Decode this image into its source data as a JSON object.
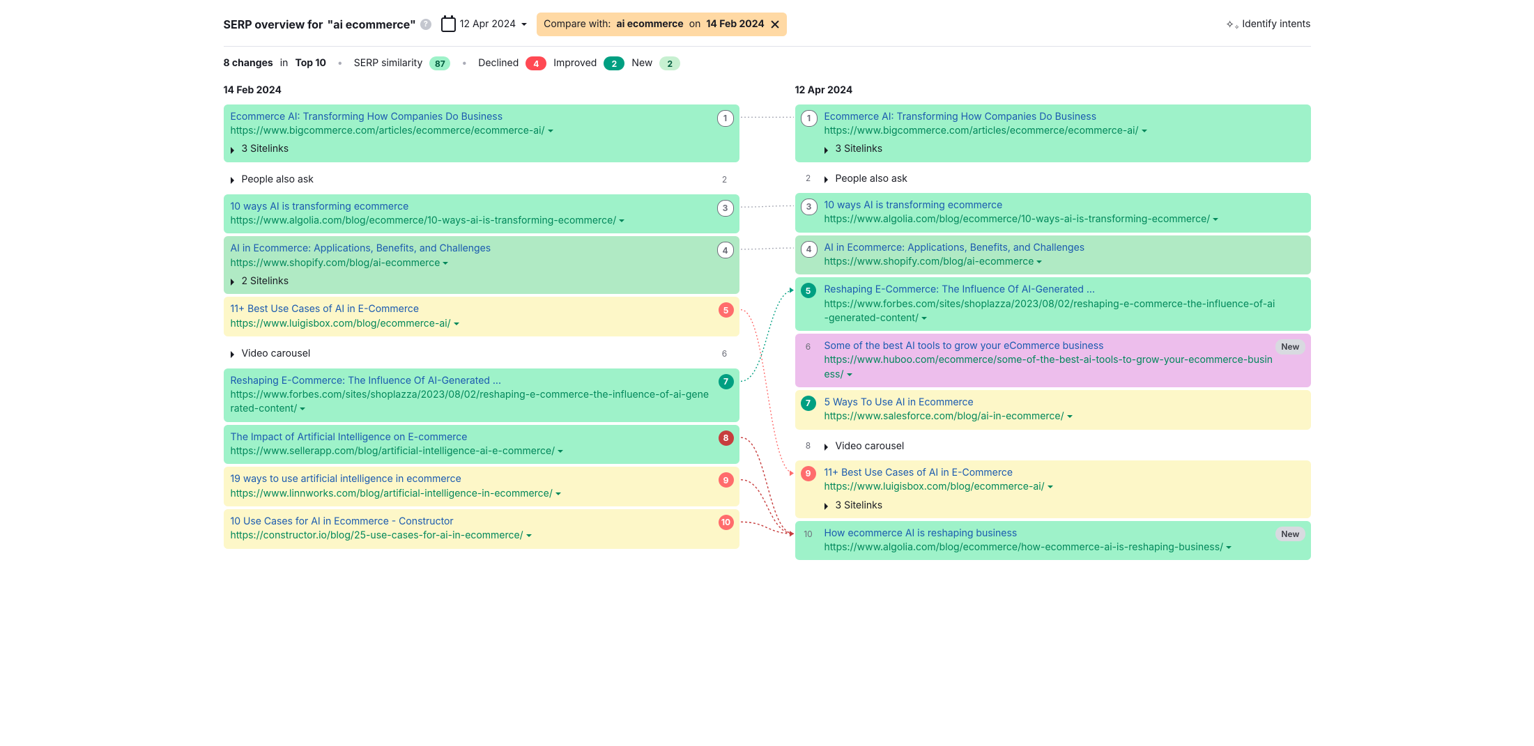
{
  "header": {
    "title_prefix": "SERP overview for",
    "query": "\"ai ecommerce\"",
    "date": "12 Apr 2024",
    "compare_prefix": "Compare with:",
    "compare_term": "ai ecommerce",
    "compare_on": "on",
    "compare_date": "14 Feb 2024",
    "identify": "Identify intents"
  },
  "stats": {
    "changes_count": "8 changes",
    "changes_suffix": " in ",
    "changes_scope": "Top 10",
    "similarity_label": "SERP similarity",
    "similarity_value": "87",
    "declined_label": "Declined",
    "declined_value": "4",
    "improved_label": "Improved",
    "improved_value": "2",
    "new_label": "New",
    "new_value": "2"
  },
  "left": {
    "date": "14 Feb 2024",
    "rows": [
      {
        "id": "l1",
        "rank": "1",
        "rank_style": "grey",
        "cls": "stable",
        "title": "Ecommerce AI: Transforming How Companies Do Business",
        "url": "https://www.bigcommerce.com/articles/ecommerce/ecommerce-ai/",
        "expander": "3 Sitelinks"
      },
      {
        "id": "l2",
        "rank": "2",
        "rank_style": "plain",
        "cls": "plain",
        "feature": "People also ask"
      },
      {
        "id": "l3",
        "rank": "3",
        "rank_style": "grey",
        "cls": "stable",
        "title": "10 ways AI is transforming ecommerce",
        "url": "https://www.algolia.com/blog/ecommerce/10-ways-ai-is-transforming-ecommerce/"
      },
      {
        "id": "l4",
        "rank": "4",
        "rank_style": "grey",
        "cls": "improved",
        "title": "AI in Ecommerce: Applications, Benefits, and Challenges",
        "url": "https://www.shopify.com/blog/ai-ecommerce",
        "expander": "2 Sitelinks"
      },
      {
        "id": "l5",
        "rank": "5",
        "rank_style": "red",
        "cls": "declined",
        "title": "11+ Best Use Cases of AI in E-Commerce",
        "url": "https://www.luigisbox.com/blog/ecommerce-ai/"
      },
      {
        "id": "l6",
        "rank": "6",
        "rank_style": "plain",
        "cls": "plain",
        "feature": "Video carousel"
      },
      {
        "id": "l7",
        "rank": "7",
        "rank_style": "green",
        "cls": "stable",
        "title": "Reshaping E-Commerce: The Influence Of AI-Generated ...",
        "url": "https://www.forbes.com/sites/shoplazza/2023/08/02/reshaping-e-commerce-the-influence-of-ai-generated-content/"
      },
      {
        "id": "l8",
        "rank": "8",
        "rank_style": "dred",
        "cls": "stable",
        "title": "The Impact of Artificial Intelligence on E-commerce",
        "url": "https://www.sellerapp.com/blog/artificial-intelligence-ai-e-commerce/"
      },
      {
        "id": "l9",
        "rank": "9",
        "rank_style": "red",
        "cls": "declined",
        "title": "19 ways to use artificial intelligence in ecommerce",
        "url": "https://www.linnworks.com/blog/artificial-intelligence-in-ecommerce/"
      },
      {
        "id": "l10",
        "rank": "10",
        "rank_style": "red",
        "cls": "declined",
        "title": "10 Use Cases for AI in Ecommerce - Constructor",
        "url": "https://constructor.io/blog/25-use-cases-for-ai-in-ecommerce/"
      }
    ]
  },
  "right": {
    "date": "12 Apr 2024",
    "rows": [
      {
        "id": "r1",
        "rank": "1",
        "rank_style": "grey",
        "cls": "stable",
        "title": "Ecommerce AI: Transforming How Companies Do Business",
        "url": "https://www.bigcommerce.com/articles/ecommerce/ecommerce-ai/",
        "expander": "3 Sitelinks"
      },
      {
        "id": "r2",
        "rank": "2",
        "rank_style": "plain",
        "cls": "plain",
        "feature": "People also ask"
      },
      {
        "id": "r3",
        "rank": "3",
        "rank_style": "grey",
        "cls": "stable",
        "title": "10 ways AI is transforming ecommerce",
        "url": "https://www.algolia.com/blog/ecommerce/10-ways-ai-is-transforming-ecommerce/"
      },
      {
        "id": "r4",
        "rank": "4",
        "rank_style": "grey",
        "cls": "improved",
        "title": "AI in Ecommerce: Applications, Benefits, and Challenges",
        "url": "https://www.shopify.com/blog/ai-ecommerce"
      },
      {
        "id": "r5",
        "rank": "5",
        "rank_style": "green",
        "cls": "stable",
        "title": "Reshaping E-Commerce: The Influence Of AI-Generated ...",
        "url": "https://www.forbes.com/sites/shoplazza/2023/08/02/reshaping-e-commerce-the-influence-of-ai-generated-content/"
      },
      {
        "id": "r6",
        "rank": "6",
        "rank_style": "plain",
        "cls": "new",
        "title": "Some of the best AI tools to grow your eCommerce business",
        "url": "https://www.huboo.com/ecommerce/some-of-the-best-ai-tools-to-grow-your-ecommerce-business/",
        "new": "New"
      },
      {
        "id": "r7",
        "rank": "7",
        "rank_style": "green",
        "cls": "declined",
        "title": "5 Ways To Use AI in Ecommerce",
        "url": "https://www.salesforce.com/blog/ai-in-ecommerce/"
      },
      {
        "id": "r8",
        "rank": "8",
        "rank_style": "plain",
        "cls": "plain",
        "feature": "Video carousel"
      },
      {
        "id": "r9",
        "rank": "9",
        "rank_style": "red",
        "cls": "declined",
        "title": "11+ Best Use Cases of AI in E-Commerce",
        "url": "https://www.luigisbox.com/blog/ecommerce-ai/",
        "expander": "3 Sitelinks"
      },
      {
        "id": "r10",
        "rank": "10",
        "rank_style": "plain",
        "cls": "stable",
        "title": "How ecommerce AI is reshaping business",
        "url": "https://www.algolia.com/blog/ecommerce/how-ecommerce-ai-is-reshaping-business/",
        "new": "New"
      }
    ]
  },
  "connections": [
    {
      "from": "l1",
      "to": "r1",
      "kind": "same"
    },
    {
      "from": "l3",
      "to": "r3",
      "kind": "same"
    },
    {
      "from": "l4",
      "to": "r4",
      "kind": "same"
    },
    {
      "from": "l5",
      "to": "r9",
      "kind": "declined"
    },
    {
      "from": "l7",
      "to": "r5",
      "kind": "improved"
    },
    {
      "from": "l8",
      "to": "r10",
      "kind": "lost"
    },
    {
      "from": "l9",
      "to": "r10",
      "kind": "lost"
    },
    {
      "from": "l10",
      "to": "r10",
      "kind": "lost"
    }
  ]
}
